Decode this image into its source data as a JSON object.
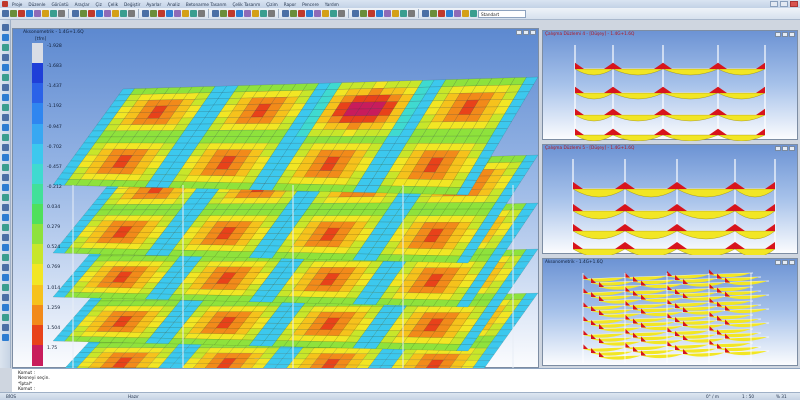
{
  "menu": [
    "Proje",
    "Düzenle",
    "Görüntü",
    "Araçlar",
    "Çiz",
    "Çelik",
    "Değiştir",
    "Ayarlar",
    "Analiz",
    "Betonarme Tasarım",
    "Çelik Tasarım",
    "Çizim",
    "Rapor",
    "Pencere",
    "Yardım"
  ],
  "toolbar": {
    "standard_label": "Standart"
  },
  "main_view": {
    "title": "Aksonometrik - 1.4G+1.6Q",
    "unit": "[tfm]",
    "legend": {
      "values": [
        "-1.928",
        "-1.683",
        "-1.437",
        "-1.192",
        "-0.947",
        "-0.702",
        "-0.457",
        "-0.212",
        "0.034",
        "0.279",
        "0.524",
        "0.769",
        "1.014",
        "1.259",
        "1.504",
        "1.75"
      ],
      "colors": [
        "#d9dde6",
        "#1f3fd8",
        "#2b62e8",
        "#2f86f0",
        "#38a8f2",
        "#3cc8ee",
        "#3fdad0",
        "#42e09a",
        "#4fe05c",
        "#8ee23c",
        "#c8e62a",
        "#f2e624",
        "#f6c21c",
        "#f28a1a",
        "#e8421a",
        "#c81c5c"
      ]
    }
  },
  "sub_views": [
    {
      "title": "Çalışma Düzlemi 4 - [Düşey] - 1.4G+1.6Q",
      "title_color": "#b3141a"
    },
    {
      "title": "Çalışma Düzlemi 5 - [Düşey] - 1.4G+1.6Q",
      "title_color": "#b3141a"
    },
    {
      "title": "Aksonometrik - 1.4G+1.6Q",
      "title_color": "#10203a"
    }
  ],
  "command_line": [
    "Komut :",
    "Nesneyi seçin.",
    "*İptal*",
    "Komut :"
  ],
  "status": {
    "left": "BİOS",
    "mode": "Hazır",
    "coords": "0° / m",
    "scale": "1 : 50",
    "zoom": "% 31"
  }
}
